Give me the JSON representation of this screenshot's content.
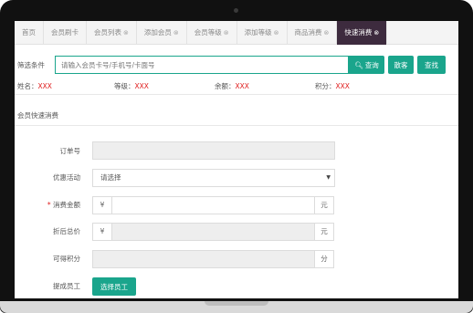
{
  "tabs": [
    {
      "label": "首页",
      "closable": false,
      "active": false
    },
    {
      "label": "会员刷卡",
      "closable": false,
      "active": false
    },
    {
      "label": "会员列表",
      "closable": true,
      "active": false
    },
    {
      "label": "添加会员",
      "closable": true,
      "active": false
    },
    {
      "label": "会员等级",
      "closable": true,
      "active": false
    },
    {
      "label": "添加等级",
      "closable": true,
      "active": false
    },
    {
      "label": "商品消费",
      "closable": true,
      "active": false
    },
    {
      "label": "快速消费",
      "closable": true,
      "active": true
    }
  ],
  "filter": {
    "label": "筛选条件",
    "placeholder": "请输入会员卡号/手机号/卡面号",
    "query_button": "查询",
    "guest_button": "散客",
    "find_button": "查找"
  },
  "member": {
    "name_label": "姓名：",
    "name_value": "XXX",
    "level_label": "等级：",
    "level_value": "XXX",
    "balance_label": "余额：",
    "balance_value": "XXX",
    "points_label": "积分：",
    "points_value": "XXX"
  },
  "section_title": "会员快速消费",
  "form": {
    "order_no_label": "订单号",
    "promo_label": "优惠活动",
    "promo_selected": "请选择",
    "amount_label": "消费金额",
    "amount_prefix": "¥",
    "amount_suffix": "元",
    "discount_total_label": "折后总价",
    "discount_prefix": "¥",
    "discount_suffix": "元",
    "points_earned_label": "可得积分",
    "points_suffix": "分",
    "staff_label": "提成员工",
    "staff_button": "选择员工"
  },
  "colors": {
    "accent": "#1aa58c",
    "active_tab": "#3d2b3e",
    "required": "#e02020"
  }
}
